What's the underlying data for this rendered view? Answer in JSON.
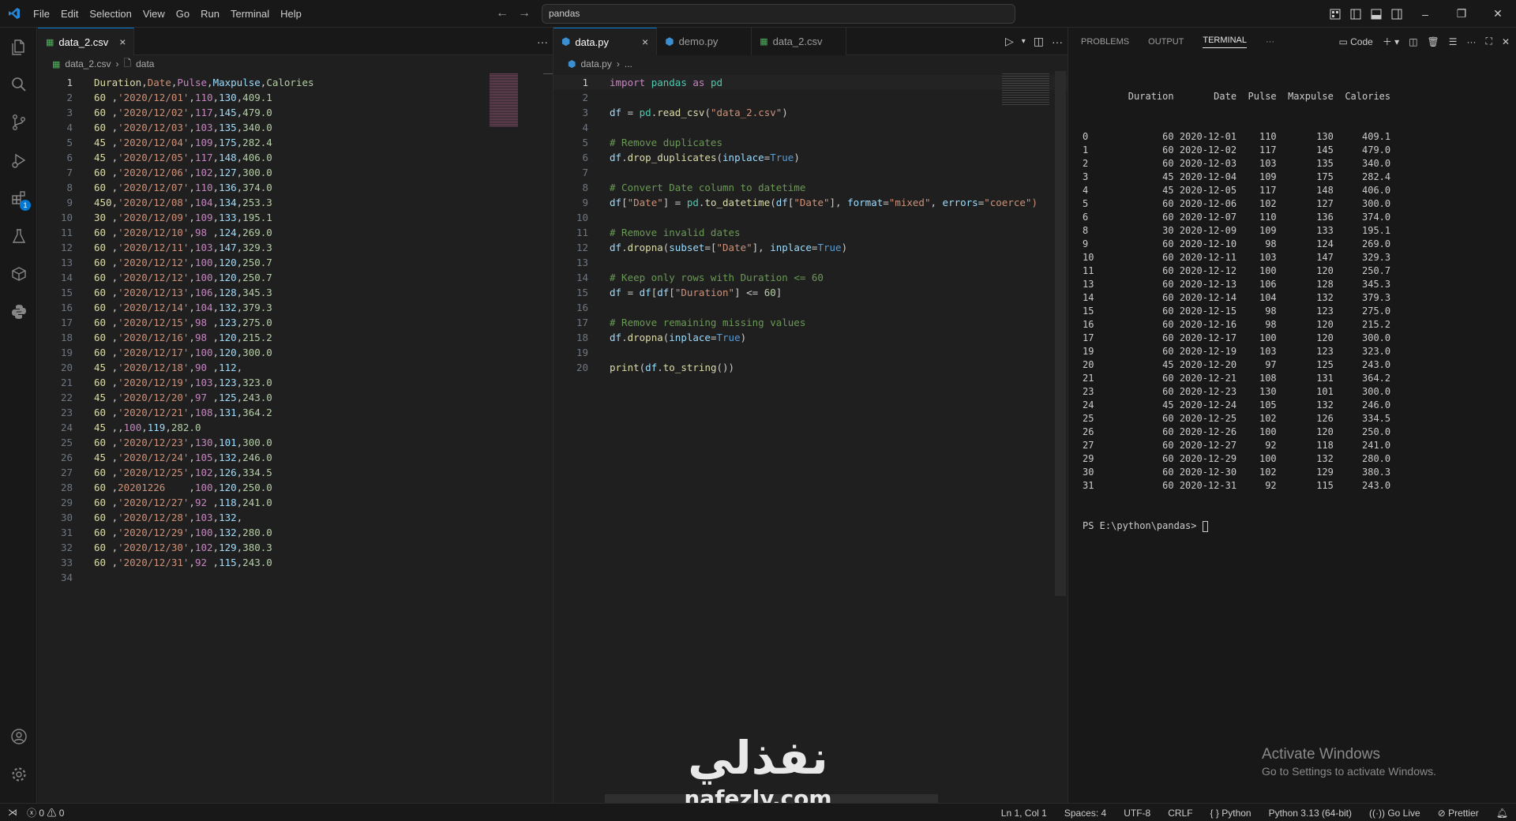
{
  "menu": [
    "File",
    "Edit",
    "Selection",
    "View",
    "Go",
    "Run",
    "Terminal",
    "Help"
  ],
  "command_center": "pandas",
  "left_editor": {
    "tab_label": "data_2.csv",
    "breadcrumb": [
      "data_2.csv",
      "data"
    ],
    "line_numbers": [
      "1",
      "2",
      "3",
      "4",
      "5",
      "6",
      "7",
      "8",
      "9",
      "10",
      "11",
      "12",
      "13",
      "14",
      "15",
      "16",
      "17",
      "18",
      "19",
      "20",
      "21",
      "22",
      "23",
      "24",
      "25",
      "26",
      "27",
      "28",
      "29",
      "30",
      "31",
      "32",
      "33",
      "34"
    ],
    "header": [
      "Duration",
      "Date",
      "Pulse",
      "Maxpulse",
      "Calories"
    ],
    "rows": [
      [
        "60 ",
        "'2020/12/01'",
        "110",
        "130",
        "409.1"
      ],
      [
        "60 ",
        "'2020/12/02'",
        "117",
        "145",
        "479.0"
      ],
      [
        "60 ",
        "'2020/12/03'",
        "103",
        "135",
        "340.0"
      ],
      [
        "45 ",
        "'2020/12/04'",
        "109",
        "175",
        "282.4"
      ],
      [
        "45 ",
        "'2020/12/05'",
        "117",
        "148",
        "406.0"
      ],
      [
        "60 ",
        "'2020/12/06'",
        "102",
        "127",
        "300.0"
      ],
      [
        "60 ",
        "'2020/12/07'",
        "110",
        "136",
        "374.0"
      ],
      [
        "450",
        "'2020/12/08'",
        "104",
        "134",
        "253.3"
      ],
      [
        "30 ",
        "'2020/12/09'",
        "109",
        "133",
        "195.1"
      ],
      [
        "60 ",
        "'2020/12/10'",
        "98 ",
        "124",
        "269.0"
      ],
      [
        "60 ",
        "'2020/12/11'",
        "103",
        "147",
        "329.3"
      ],
      [
        "60 ",
        "'2020/12/12'",
        "100",
        "120",
        "250.7"
      ],
      [
        "60 ",
        "'2020/12/12'",
        "100",
        "120",
        "250.7"
      ],
      [
        "60 ",
        "'2020/12/13'",
        "106",
        "128",
        "345.3"
      ],
      [
        "60 ",
        "'2020/12/14'",
        "104",
        "132",
        "379.3"
      ],
      [
        "60 ",
        "'2020/12/15'",
        "98 ",
        "123",
        "275.0"
      ],
      [
        "60 ",
        "'2020/12/16'",
        "98 ",
        "120",
        "215.2"
      ],
      [
        "60 ",
        "'2020/12/17'",
        "100",
        "120",
        "300.0"
      ],
      [
        "45 ",
        "'2020/12/18'",
        "90 ",
        "112",
        ""
      ],
      [
        "60 ",
        "'2020/12/19'",
        "103",
        "123",
        "323.0"
      ],
      [
        "45 ",
        "'2020/12/20'",
        "97 ",
        "125",
        "243.0"
      ],
      [
        "60 ",
        "'2020/12/21'",
        "108",
        "131",
        "364.2"
      ],
      [
        "45 ",
        "",
        "100",
        "119",
        "282.0"
      ],
      [
        "60 ",
        "'2020/12/23'",
        "130",
        "101",
        "300.0"
      ],
      [
        "45 ",
        "'2020/12/24'",
        "105",
        "132",
        "246.0"
      ],
      [
        "60 ",
        "'2020/12/25'",
        "102",
        "126",
        "334.5"
      ],
      [
        "60 ",
        "20201226    ",
        "100",
        "120",
        "250.0"
      ],
      [
        "60 ",
        "'2020/12/27'",
        "92 ",
        "118",
        "241.0"
      ],
      [
        "60 ",
        "'2020/12/28'",
        "103",
        "132",
        ""
      ],
      [
        "60 ",
        "'2020/12/29'",
        "100",
        "132",
        "280.0"
      ],
      [
        "60 ",
        "'2020/12/30'",
        "102",
        "129",
        "380.3"
      ],
      [
        "60 ",
        "'2020/12/31'",
        "92 ",
        "115",
        "243.0"
      ]
    ]
  },
  "right_editor": {
    "tabs": [
      "data.py",
      "demo.py",
      "data_2.csv"
    ],
    "breadcrumb": [
      "data.py",
      "..."
    ],
    "line_numbers": [
      "1",
      "2",
      "3",
      "4",
      "5",
      "6",
      "7",
      "8",
      "9",
      "10",
      "11",
      "12",
      "13",
      "14",
      "15",
      "16",
      "17",
      "18",
      "19",
      "20"
    ],
    "code": [
      [
        [
          "kw",
          "import"
        ],
        [
          "pl",
          " "
        ],
        [
          "mod",
          "pandas"
        ],
        [
          "pl",
          " "
        ],
        [
          "kw",
          "as"
        ],
        [
          "pl",
          " "
        ],
        [
          "mod",
          "pd"
        ]
      ],
      [],
      [
        [
          "var",
          "df"
        ],
        [
          "pl",
          " = "
        ],
        [
          "mod",
          "pd"
        ],
        [
          "pl",
          "."
        ],
        [
          "fn",
          "read_csv"
        ],
        [
          "pl",
          "("
        ],
        [
          "str",
          "\"data_2.csv\""
        ],
        [
          "pl",
          ")"
        ]
      ],
      [],
      [
        [
          "cm",
          "# Remove duplicates"
        ]
      ],
      [
        [
          "var",
          "df"
        ],
        [
          "pl",
          "."
        ],
        [
          "fn",
          "drop_duplicates"
        ],
        [
          "pl",
          "("
        ],
        [
          "var",
          "inplace"
        ],
        [
          "pl",
          "="
        ],
        [
          "bool",
          "True"
        ],
        [
          "pl",
          ")"
        ]
      ],
      [],
      [
        [
          "cm",
          "# Convert Date column to datetime"
        ]
      ],
      [
        [
          "var",
          "df"
        ],
        [
          "pl",
          "["
        ],
        [
          "str",
          "\"Date\""
        ],
        [
          "pl",
          "] = "
        ],
        [
          "mod",
          "pd"
        ],
        [
          "pl",
          "."
        ],
        [
          "fn",
          "to_datetime"
        ],
        [
          "pl",
          "("
        ],
        [
          "var",
          "df"
        ],
        [
          "pl",
          "["
        ],
        [
          "str",
          "\"Date\""
        ],
        [
          "pl",
          "], "
        ],
        [
          "var",
          "format"
        ],
        [
          "pl",
          "="
        ],
        [
          "str",
          "\"mixed\""
        ],
        [
          "pl",
          ", "
        ],
        [
          "var",
          "errors"
        ],
        [
          "pl",
          "="
        ],
        [
          "str",
          "\"coerce\")"
        ]
      ],
      [],
      [
        [
          "cm",
          "# Remove invalid dates"
        ]
      ],
      [
        [
          "var",
          "df"
        ],
        [
          "pl",
          "."
        ],
        [
          "fn",
          "dropna"
        ],
        [
          "pl",
          "("
        ],
        [
          "var",
          "subset"
        ],
        [
          "pl",
          "=["
        ],
        [
          "str",
          "\"Date\""
        ],
        [
          "pl",
          "], "
        ],
        [
          "var",
          "inplace"
        ],
        [
          "pl",
          "="
        ],
        [
          "bool",
          "True"
        ],
        [
          "pl",
          ")"
        ]
      ],
      [],
      [
        [
          "cm",
          "# Keep only rows with Duration <= 60"
        ]
      ],
      [
        [
          "var",
          "df"
        ],
        [
          "pl",
          " = "
        ],
        [
          "var",
          "df"
        ],
        [
          "pl",
          "["
        ],
        [
          "var",
          "df"
        ],
        [
          "pl",
          "["
        ],
        [
          "str",
          "\"Duration\""
        ],
        [
          "pl",
          "] <= "
        ],
        [
          "num",
          "60"
        ],
        [
          "pl",
          "]"
        ]
      ],
      [],
      [
        [
          "cm",
          "# Remove remaining missing values"
        ]
      ],
      [
        [
          "var",
          "df"
        ],
        [
          "pl",
          "."
        ],
        [
          "fn",
          "dropna"
        ],
        [
          "pl",
          "("
        ],
        [
          "var",
          "inplace"
        ],
        [
          "pl",
          "="
        ],
        [
          "bool",
          "True"
        ],
        [
          "pl",
          ")"
        ]
      ],
      [],
      [
        [
          "fn",
          "print"
        ],
        [
          "pl",
          "("
        ],
        [
          "var",
          "df"
        ],
        [
          "pl",
          "."
        ],
        [
          "fn",
          "to_string"
        ],
        [
          "pl",
          "())"
        ]
      ]
    ]
  },
  "panel": {
    "tabs": [
      "PROBLEMS",
      "OUTPUT",
      "TERMINAL"
    ],
    "active": "TERMINAL",
    "launch_label": "Code",
    "terminal_header": "        Duration       Date  Pulse  Maxpulse  Calories",
    "terminal_rows": [
      "0             60 2020-12-01    110       130     409.1",
      "1             60 2020-12-02    117       145     479.0",
      "2             60 2020-12-03    103       135     340.0",
      "3             45 2020-12-04    109       175     282.4",
      "4             45 2020-12-05    117       148     406.0",
      "5             60 2020-12-06    102       127     300.0",
      "6             60 2020-12-07    110       136     374.0",
      "8             30 2020-12-09    109       133     195.1",
      "9             60 2020-12-10     98       124     269.0",
      "10            60 2020-12-11    103       147     329.3",
      "11            60 2020-12-12    100       120     250.7",
      "13            60 2020-12-13    106       128     345.3",
      "14            60 2020-12-14    104       132     379.3",
      "15            60 2020-12-15     98       123     275.0",
      "16            60 2020-12-16     98       120     215.2",
      "17            60 2020-12-17    100       120     300.0",
      "19            60 2020-12-19    103       123     323.0",
      "20            45 2020-12-20     97       125     243.0",
      "21            60 2020-12-21    108       131     364.2",
      "23            60 2020-12-23    130       101     300.0",
      "24            45 2020-12-24    105       132     246.0",
      "25            60 2020-12-25    102       126     334.5",
      "26            60 2020-12-26    100       120     250.0",
      "27            60 2020-12-27     92       118     241.0",
      "29            60 2020-12-29    100       132     280.0",
      "30            60 2020-12-30    102       129     380.3",
      "31            60 2020-12-31     92       115     243.0"
    ],
    "prompt": "PS E:\\python\\pandas> "
  },
  "statusbar": {
    "errors": "0",
    "warnings": "0",
    "position": "Ln 1, Col 1",
    "spaces": "Spaces: 4",
    "encoding": "UTF-8",
    "eol": "CRLF",
    "language": "Python",
    "interpreter": "Python 3.13 (64-bit)",
    "golive": "Go Live",
    "prettier": "Prettier"
  },
  "watermark": {
    "title": "Activate Windows",
    "subtitle": "Go to Settings to activate Windows."
  },
  "brand": {
    "arabic": "نفذلي",
    "url": "nafezly.com"
  },
  "colors": {
    "accent": "#0078d4",
    "editor_bg": "#1f1f1f",
    "chrome_bg": "#181818"
  }
}
